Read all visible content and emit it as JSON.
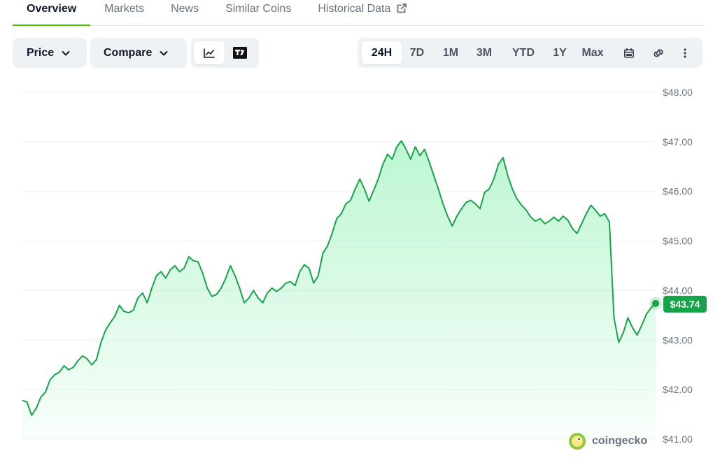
{
  "tabs": [
    {
      "label": "Overview",
      "active": true
    },
    {
      "label": "Markets"
    },
    {
      "label": "News"
    },
    {
      "label": "Similar Coins"
    },
    {
      "label": "Historical Data"
    }
  ],
  "toolbar": {
    "price_label": "Price",
    "compare_label": "Compare",
    "view_icons": [
      "line-chart-icon",
      "tradingview-icon"
    ],
    "ranges": [
      "24H",
      "7D",
      "1M",
      "3M",
      "YTD",
      "1Y",
      "Max"
    ],
    "active_range": "24H",
    "extra_icons": [
      "calendar-icon",
      "link-icon",
      "more-vertical-icon"
    ]
  },
  "colors": {
    "line": "#16a34a",
    "fill": "#86efac",
    "badge": "#16a34a",
    "accent": "#4bcc00"
  },
  "watermark": {
    "text": "coingecko"
  },
  "current_price": "$43.74",
  "chart_data": {
    "type": "area",
    "y_tick_labels": [
      "$48.00",
      "$47.00",
      "$46.00",
      "$45.00",
      "$44.00",
      "$43.00",
      "$42.00",
      "$41.00"
    ],
    "ylim": [
      41,
      48
    ],
    "grid": true,
    "series": [
      {
        "values": [
          41.78,
          41.75,
          41.48,
          41.62,
          41.85,
          41.95,
          42.2,
          42.3,
          42.35,
          42.48,
          42.4,
          42.45,
          42.58,
          42.68,
          42.62,
          42.5,
          42.6,
          42.95,
          43.2,
          43.35,
          43.48,
          43.7,
          43.58,
          43.55,
          43.6,
          43.85,
          43.95,
          43.75,
          44.05,
          44.3,
          44.38,
          44.25,
          44.42,
          44.5,
          44.38,
          44.45,
          44.68,
          44.6,
          44.58,
          44.35,
          44.05,
          43.88,
          43.92,
          44.05,
          44.25,
          44.5,
          44.3,
          44.05,
          43.75,
          43.85,
          44.0,
          43.85,
          43.75,
          43.95,
          44.05,
          43.98,
          44.05,
          44.15,
          44.18,
          44.1,
          44.38,
          44.52,
          44.45,
          44.15,
          44.3,
          44.75,
          44.9,
          45.15,
          45.45,
          45.55,
          45.75,
          45.82,
          46.05,
          46.25,
          46.05,
          45.8,
          46.02,
          46.25,
          46.55,
          46.75,
          46.65,
          46.9,
          47.02,
          46.85,
          46.65,
          46.9,
          46.72,
          46.85,
          46.6,
          46.32,
          46.05,
          45.75,
          45.5,
          45.3,
          45.5,
          45.65,
          45.78,
          45.82,
          45.75,
          45.65,
          45.98,
          46.05,
          46.25,
          46.55,
          46.68,
          46.32,
          46.05,
          45.85,
          45.72,
          45.62,
          45.48,
          45.4,
          45.45,
          45.35,
          45.4,
          45.48,
          45.4,
          45.5,
          45.42,
          45.25,
          45.15,
          45.35,
          45.55,
          45.72,
          45.62,
          45.5,
          45.55,
          45.38,
          43.45,
          42.95,
          43.15,
          43.45,
          43.25,
          43.1,
          43.3,
          43.52,
          43.65,
          43.74
        ]
      }
    ]
  }
}
